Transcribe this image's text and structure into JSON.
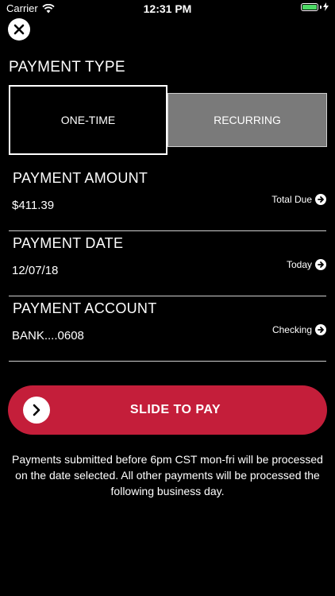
{
  "status_bar": {
    "carrier": "Carrier",
    "time": "12:31 PM",
    "battery_level": 1.0,
    "battery_color": "#4cd964"
  },
  "payment_type": {
    "title": "PAYMENT TYPE",
    "options": [
      {
        "label": "ONE-TIME",
        "selected": true
      },
      {
        "label": "RECURRING",
        "selected": false
      }
    ]
  },
  "amount": {
    "label": "PAYMENT AMOUNT",
    "value": "$411.39",
    "link": "Total Due"
  },
  "date": {
    "label": "PAYMENT DATE",
    "value": "12/07/18",
    "link": "Today"
  },
  "account": {
    "label": "PAYMENT ACCOUNT",
    "value": "BANK....0608",
    "link": "Checking"
  },
  "slide": {
    "label": "SLIDE TO PAY",
    "color": "#c41e3a"
  },
  "note": "Payments submitted before 6pm CST mon-fri will be processed on the date selected. All other payments will be processed the following business day."
}
